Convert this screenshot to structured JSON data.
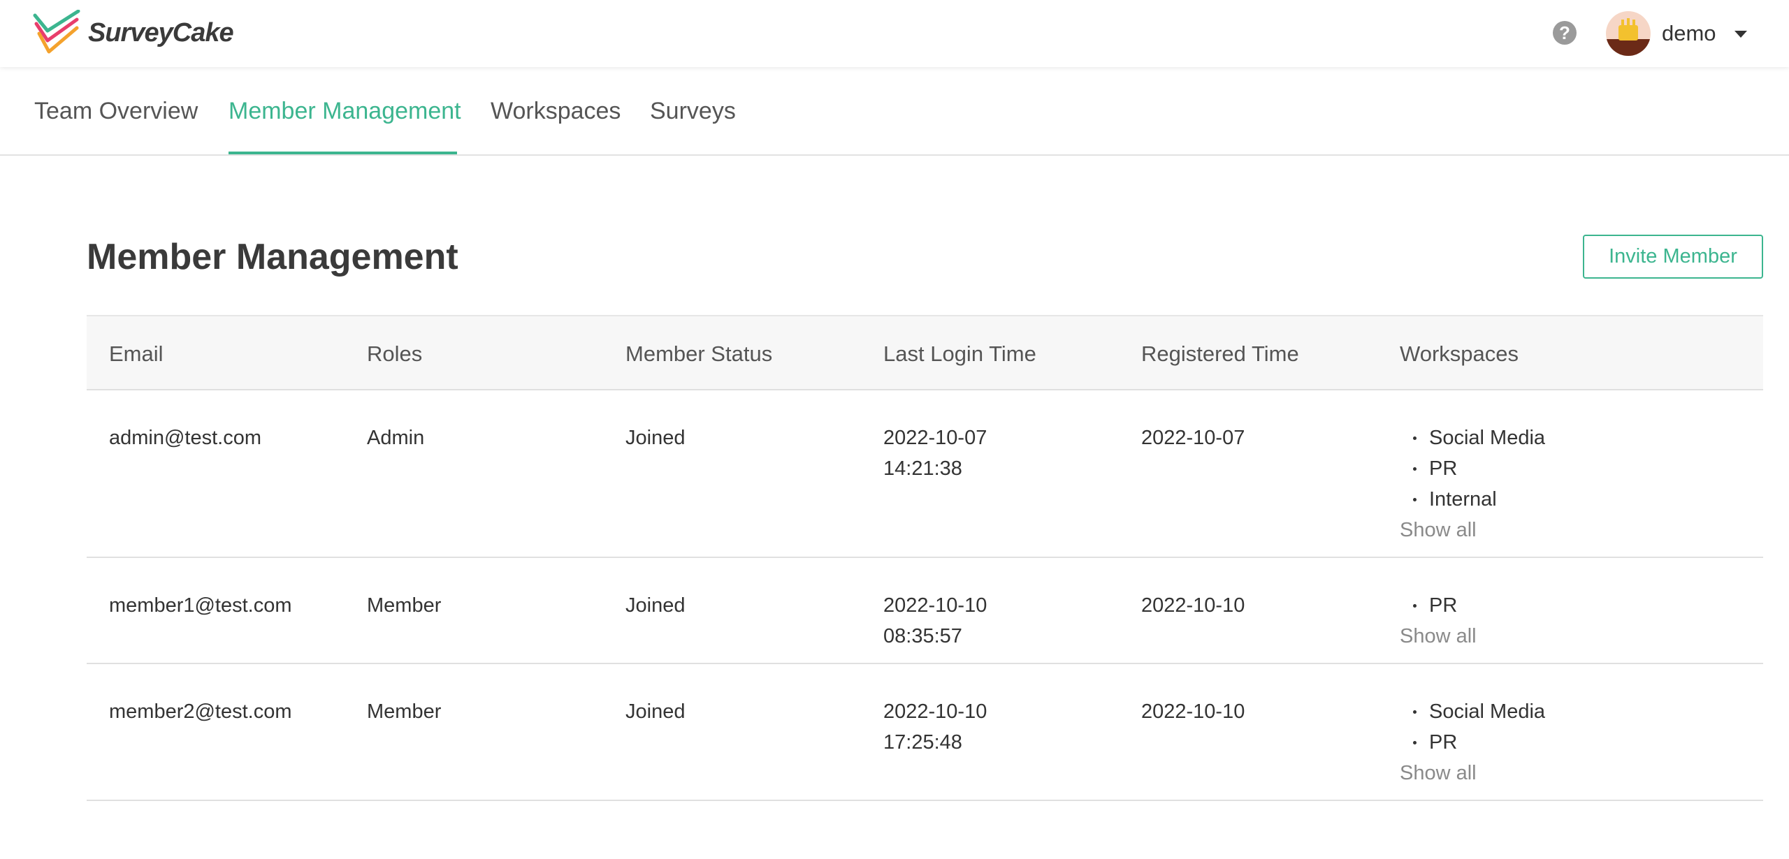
{
  "app": {
    "brand": "SurveyCake",
    "colors": {
      "accent": "#3cb58f",
      "text": "#333333",
      "muted": "#8a8a8a"
    }
  },
  "header": {
    "help_icon": "question-circle-icon",
    "help_glyph": "?",
    "user": {
      "name": "demo",
      "avatar": "avatar-image",
      "menu_icon": "caret-down-icon"
    }
  },
  "tabs": [
    {
      "label": "Team Overview",
      "active": false
    },
    {
      "label": "Member Management",
      "active": true
    },
    {
      "label": "Workspaces",
      "active": false
    },
    {
      "label": "Surveys",
      "active": false
    }
  ],
  "main": {
    "title": "Member Management",
    "invite_label": "Invite Member"
  },
  "table": {
    "columns": [
      "Email",
      "Roles",
      "Member Status",
      "Last Login Time",
      "Registered Time",
      "Workspaces"
    ],
    "show_all_label": "Show all",
    "rows": [
      {
        "email": "admin@test.com",
        "role": "Admin",
        "status": "Joined",
        "last_login_date": "2022-10-07",
        "last_login_time": "14:21:38",
        "registered": "2022-10-07",
        "workspaces": [
          "Social Media",
          "PR",
          "Internal"
        ]
      },
      {
        "email": "member1@test.com",
        "role": "Member",
        "status": "Joined",
        "last_login_date": "2022-10-10",
        "last_login_time": "08:35:57",
        "registered": "2022-10-10",
        "workspaces": [
          "PR"
        ]
      },
      {
        "email": "member2@test.com",
        "role": "Member",
        "status": "Joined",
        "last_login_date": "2022-10-10",
        "last_login_time": "17:25:48",
        "registered": "2022-10-10",
        "workspaces": [
          "Social Media",
          "PR"
        ]
      }
    ]
  }
}
